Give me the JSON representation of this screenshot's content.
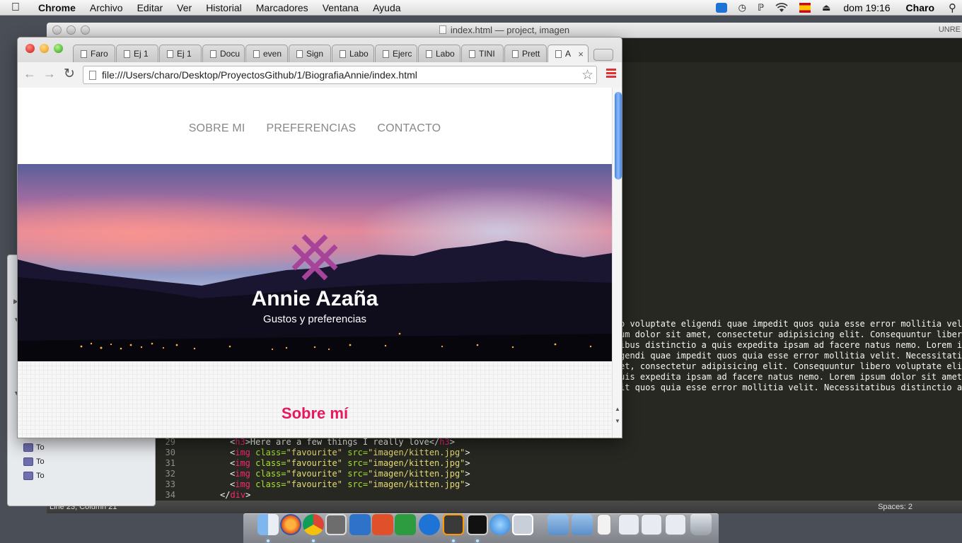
{
  "menubar": {
    "app": "Chrome",
    "menus": [
      "Archivo",
      "Editar",
      "Ver",
      "Historial",
      "Marcadores",
      "Ventana",
      "Ayuda"
    ],
    "clock": "dom 19:16",
    "user": "Charo"
  },
  "editor": {
    "title": "index.html — project, imagen",
    "unregistered": "UNRE",
    "status_position": "Line 23, Column 21",
    "status_spaces": "Spaces: 2",
    "line_numbers": [
      "29",
      "30",
      "31",
      "32",
      "33",
      "34"
    ],
    "code": {
      "l29": "Here are a few things I really love",
      "img_tag": "img",
      "class_attr": "class=",
      "class_val": "\"favourite\"",
      "src_attr": "src=",
      "src_val": "\"imagen/kitten.jpg\"",
      "div_close": "div"
    },
    "lorem_lines": [
      "o voluptate eligendi quae impedit quos quia esse error mollitia velit",
      "um dolor sit amet, consectetur adipisicing elit. Consequuntur libero",
      "ibus distinctio a quis expedita ipsam ad facere natus nemo. Lorem ips",
      "gendi quae impedit quos quia esse error mollitia velit. Necessitatibu",
      "et, consectetur adipisicing elit. Consequuntur libero voluptate elige",
      "uis expedita ipsam ad facere natus nemo. Lorem ipsum dolor sit amet,",
      "it quos quia esse error mollitia velit. Necessitatibus distinctio a q"
    ]
  },
  "finder": {
    "items": [
      "To",
      "To",
      "To"
    ]
  },
  "chrome": {
    "tabs": [
      "Faro",
      "Ej 1",
      "Ej 1",
      "Docu",
      "even",
      "Sign",
      "Labo",
      "Ejerc",
      "Labo",
      "TINI",
      "Prett"
    ],
    "active_tab": "A",
    "url": "file:///Users/charo/Desktop/ProyectosGithub/1/BiografiaAnnie/index.html"
  },
  "page": {
    "nav": [
      "SOBRE MI",
      "PREFERENCIAS",
      "CONTACTO"
    ],
    "hero_name": "Annie Azaña",
    "hero_tagline": "Gustos y preferencias",
    "section_title": "Sobre mí",
    "accent_color": "#e8175d",
    "logo_color": "#a8439a"
  },
  "dock": {
    "icons": [
      "finder-icon",
      "firefox-icon",
      "chrome-icon",
      "preview-icon",
      "word-icon",
      "powerpoint-icon",
      "excel-icon",
      "teamviewer-icon",
      "sublime-icon",
      "terminal-icon",
      "itunes-icon",
      "photos-icon",
      "apps-folder-icon",
      "documents-folder-icon",
      "file-icon",
      "finder-window-icon",
      "safari-window-icon",
      "chrome-window-icon",
      "trash-icon"
    ]
  }
}
